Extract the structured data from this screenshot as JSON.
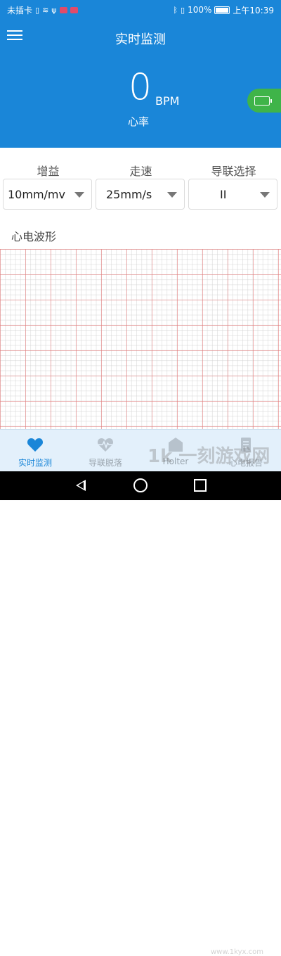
{
  "statusbar": {
    "carrier": "未插卡",
    "battery": "100%",
    "time": "上午10:39"
  },
  "header": {
    "title": "实时监测",
    "heart_rate_value": "0",
    "heart_rate_unit": "BPM",
    "heart_rate_label": "心率",
    "accent_color": "#1a86d8",
    "device_battery_color": "#3fb449"
  },
  "controls": [
    {
      "label": "增益",
      "value": "10mm/mv"
    },
    {
      "label": "走速",
      "value": "25mm/s"
    },
    {
      "label": "导联选择",
      "value": "II"
    }
  ],
  "waveform": {
    "title": "心电波形"
  },
  "tabs": [
    {
      "label": "实时监测",
      "icon": "heart-icon",
      "active": true
    },
    {
      "label": "导联脱落",
      "icon": "ecg-pulse-icon",
      "active": false
    },
    {
      "label": "Holter",
      "icon": "home-shape-icon",
      "active": false
    },
    {
      "label": "心电报告",
      "icon": "report-icon",
      "active": false
    }
  ],
  "watermark": {
    "text": "1k 一刻游戏网",
    "url": "www.1kyx.com"
  }
}
